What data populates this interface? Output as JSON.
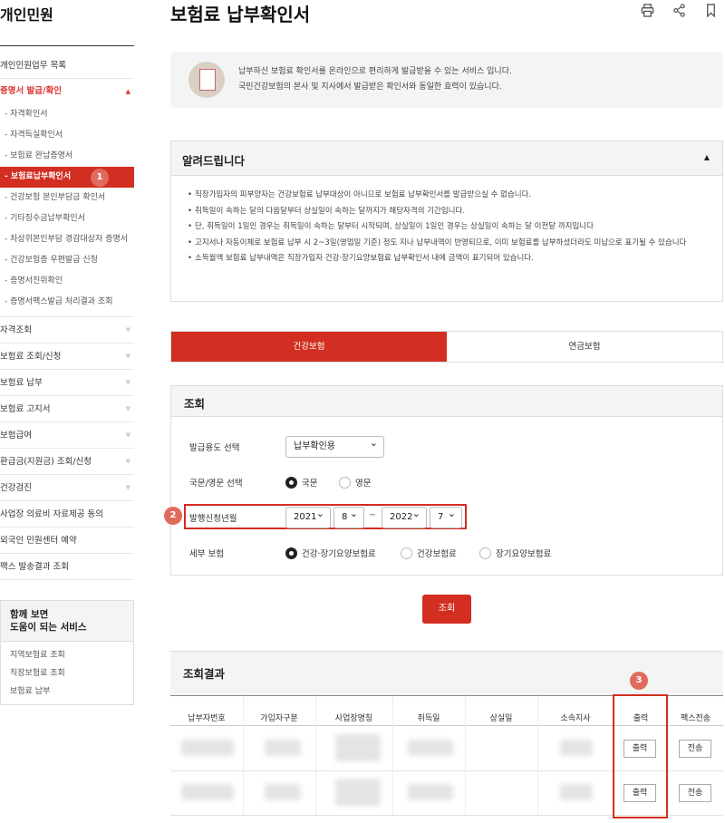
{
  "sidebar": {
    "title": "개인민원",
    "items": [
      {
        "label": "개인민원업무 목록"
      },
      {
        "label": "증명서 발급/확인"
      }
    ],
    "subitems": [
      "자격확인서",
      "자격득실확인서",
      "보험료 완납증명서",
      "보험료납부확인서",
      "건강보험 본인부담금 확인서",
      "기타징수금납부확인서",
      "차상위본인부담 경감대상자 증명서",
      "건강보험증 우편발급 신청",
      "증명서진위확인",
      "증명서팩스발급 처리결과 조회"
    ],
    "lower": [
      "자격조회",
      "보험료 조회/신청",
      "보험료 납부",
      "보험료 고지서",
      "보험급여",
      "환급금(지원금) 조회/신청",
      "건강검진",
      "사업장 의료비 자료제공 동의",
      "외국인 민원센터 예약",
      "팩스 발송결과 조회"
    ],
    "help_title": "함께 보면\n도움이 되는 서비스",
    "help_items": [
      "지역보험료 조회",
      "직장보험료 조회",
      "보험료 납부"
    ]
  },
  "badges": {
    "b1": "1",
    "b2": "2",
    "b3": "3"
  },
  "page": {
    "title": "보험료 납부확인서"
  },
  "intro": {
    "line1": "납부하신 보험료 확인서를 온라인으로 편리하게 발급받을 수 있는 서비스 입니다.",
    "line2": "국민건강보험의 본사 및 지사에서 발급받은 확인서와 동일한 효력이 있습니다."
  },
  "notice": {
    "title": "알려드립니다",
    "items": [
      "직장가입자의 피부양자는 건강보험료 납부대상이 아니므로 보험료 납부확인서를 발급받으실 수 없습니다.",
      "취득일이 속하는 달의 다음달부터 상실일이 속하는 달까지가 해당자격의 기간입니다.",
      "단, 취득일이 1일인 경우는 취득일이 속하는 달부터 시작되며, 상실일이 1일인 경우는 상실일이 속하는 달 이전달 까지입니다",
      "고지서나 자동이체로 보험료 납부 시 2~3일(영업일 기준) 정도 지나 납부내역이 반영되므로, 이미 보험료를 납부하셨더라도 미납으로 표기될 수 있습니다",
      "소득월액 보험료 납부내역은 직장가입자 건강·장기요양보험료 납부확인서 내에 금액이 표기되어 있습니다."
    ]
  },
  "tabs": [
    "건강보험",
    "연금보험"
  ],
  "query": {
    "title": "조회",
    "purpose_label": "발급용도 선택",
    "purpose_value": "납부확인용",
    "lang_label": "국문/영문 선택",
    "lang_opts": [
      "국문",
      "영문"
    ],
    "period_label": "발행신청년월",
    "from_year": "2021",
    "from_month": "8",
    "tilde": "~",
    "to_year": "2022",
    "to_month": "7",
    "ins_label": "세부 보험",
    "ins_opts": [
      "건강·장기요양보험료",
      "건강보험료",
      "장기요양보험료"
    ],
    "button": "조회"
  },
  "results": {
    "title": "조회결과",
    "headers": [
      "납부자번호",
      "가입자구분",
      "사업장명칭",
      "취득일",
      "상실일",
      "소속지사",
      "출력",
      "팩스전송"
    ],
    "print_label": "출력",
    "fax_label": "전송"
  }
}
